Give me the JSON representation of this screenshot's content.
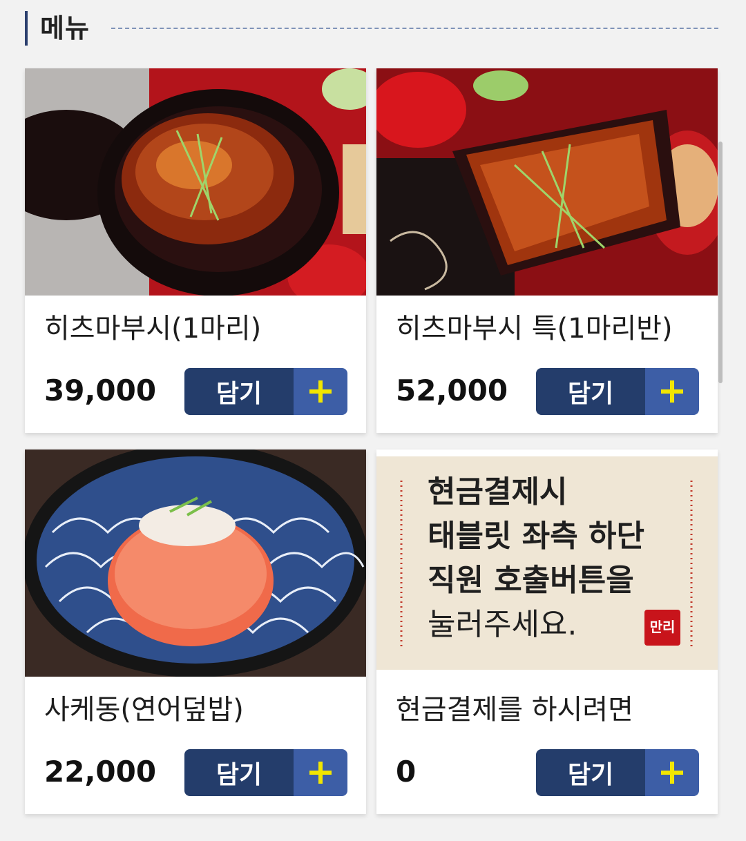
{
  "header": {
    "title": "메뉴"
  },
  "items": [
    {
      "name": "히츠마부시(1마리)",
      "price": "39,000",
      "add_label": "담기",
      "photo": "unagi-hitsumabushi-bowl"
    },
    {
      "name": "히츠마부시 특(1마리반)",
      "price": "52,000",
      "add_label": "담기",
      "photo": "unagi-hitsumabushi-box"
    },
    {
      "name": "사케동(연어덮밥)",
      "price": "22,000",
      "add_label": "담기",
      "photo": "salmon-sakedon-bowl"
    },
    {
      "name": "현금결제를 하시려면",
      "price": "0",
      "add_label": "담기",
      "photo": "cash-payment-notice"
    }
  ],
  "notice": {
    "lines": [
      "현금결제시",
      "태블릿 좌측 하단",
      "직원 호출버튼을",
      "눌러주세요."
    ],
    "stamp": "만리"
  },
  "colors": {
    "button_main": "#243d6b",
    "button_plus": "#3d5ea6",
    "plus_icon": "#f2e600",
    "header_bar": "#2b3f6e"
  },
  "icons": {
    "add": "plus-icon"
  }
}
